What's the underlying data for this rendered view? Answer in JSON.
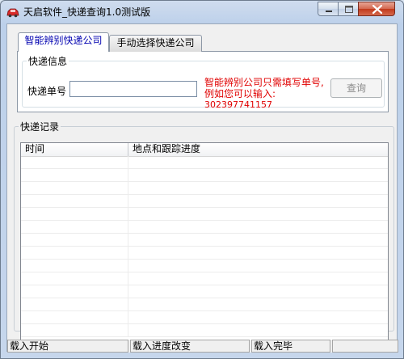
{
  "window": {
    "title": "天启软件_快递查询1.0测试版",
    "icon": "red-car-app-icon",
    "controls": [
      "minimize-icon",
      "maximize-icon",
      "close-icon"
    ]
  },
  "tabs": [
    {
      "label": "智能辨别快递公司",
      "active": true
    },
    {
      "label": "手动选择快递公司",
      "active": false
    }
  ],
  "info_group": {
    "legend": "快递信息",
    "number_label": "快递单号",
    "number_value": "",
    "hint_line1": "智能辨别公司只需填写单号,",
    "hint_line2": "例如您可以输入:",
    "hint_example": "302397741157",
    "query_button": "查询",
    "hint_color": "#e00000"
  },
  "records_group": {
    "legend": "快递记录",
    "columns": [
      "时间",
      "地点和跟踪进度"
    ],
    "rows": []
  },
  "statusbar": [
    "载入开始",
    "载入进度改变",
    "载入完毕",
    ""
  ]
}
